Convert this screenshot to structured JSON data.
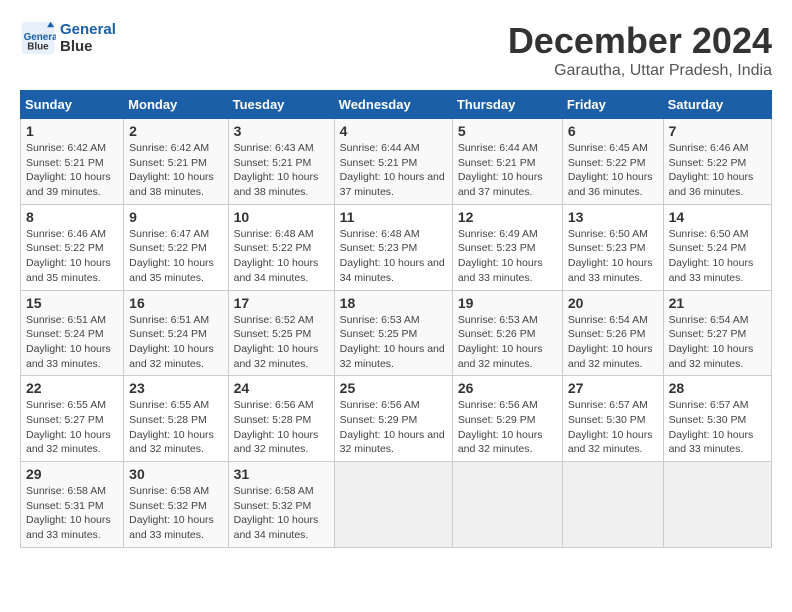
{
  "logo": {
    "line1": "General",
    "line2": "Blue"
  },
  "title": "December 2024",
  "subtitle": "Garautha, Uttar Pradesh, India",
  "weekdays": [
    "Sunday",
    "Monday",
    "Tuesday",
    "Wednesday",
    "Thursday",
    "Friday",
    "Saturday"
  ],
  "weeks": [
    [
      {
        "day": "1",
        "info": "Sunrise: 6:42 AM\nSunset: 5:21 PM\nDaylight: 10 hours and 39 minutes."
      },
      {
        "day": "2",
        "info": "Sunrise: 6:42 AM\nSunset: 5:21 PM\nDaylight: 10 hours and 38 minutes."
      },
      {
        "day": "3",
        "info": "Sunrise: 6:43 AM\nSunset: 5:21 PM\nDaylight: 10 hours and 38 minutes."
      },
      {
        "day": "4",
        "info": "Sunrise: 6:44 AM\nSunset: 5:21 PM\nDaylight: 10 hours and 37 minutes."
      },
      {
        "day": "5",
        "info": "Sunrise: 6:44 AM\nSunset: 5:21 PM\nDaylight: 10 hours and 37 minutes."
      },
      {
        "day": "6",
        "info": "Sunrise: 6:45 AM\nSunset: 5:22 PM\nDaylight: 10 hours and 36 minutes."
      },
      {
        "day": "7",
        "info": "Sunrise: 6:46 AM\nSunset: 5:22 PM\nDaylight: 10 hours and 36 minutes."
      }
    ],
    [
      {
        "day": "8",
        "info": "Sunrise: 6:46 AM\nSunset: 5:22 PM\nDaylight: 10 hours and 35 minutes."
      },
      {
        "day": "9",
        "info": "Sunrise: 6:47 AM\nSunset: 5:22 PM\nDaylight: 10 hours and 35 minutes."
      },
      {
        "day": "10",
        "info": "Sunrise: 6:48 AM\nSunset: 5:22 PM\nDaylight: 10 hours and 34 minutes."
      },
      {
        "day": "11",
        "info": "Sunrise: 6:48 AM\nSunset: 5:23 PM\nDaylight: 10 hours and 34 minutes."
      },
      {
        "day": "12",
        "info": "Sunrise: 6:49 AM\nSunset: 5:23 PM\nDaylight: 10 hours and 33 minutes."
      },
      {
        "day": "13",
        "info": "Sunrise: 6:50 AM\nSunset: 5:23 PM\nDaylight: 10 hours and 33 minutes."
      },
      {
        "day": "14",
        "info": "Sunrise: 6:50 AM\nSunset: 5:24 PM\nDaylight: 10 hours and 33 minutes."
      }
    ],
    [
      {
        "day": "15",
        "info": "Sunrise: 6:51 AM\nSunset: 5:24 PM\nDaylight: 10 hours and 33 minutes."
      },
      {
        "day": "16",
        "info": "Sunrise: 6:51 AM\nSunset: 5:24 PM\nDaylight: 10 hours and 32 minutes."
      },
      {
        "day": "17",
        "info": "Sunrise: 6:52 AM\nSunset: 5:25 PM\nDaylight: 10 hours and 32 minutes."
      },
      {
        "day": "18",
        "info": "Sunrise: 6:53 AM\nSunset: 5:25 PM\nDaylight: 10 hours and 32 minutes."
      },
      {
        "day": "19",
        "info": "Sunrise: 6:53 AM\nSunset: 5:26 PM\nDaylight: 10 hours and 32 minutes."
      },
      {
        "day": "20",
        "info": "Sunrise: 6:54 AM\nSunset: 5:26 PM\nDaylight: 10 hours and 32 minutes."
      },
      {
        "day": "21",
        "info": "Sunrise: 6:54 AM\nSunset: 5:27 PM\nDaylight: 10 hours and 32 minutes."
      }
    ],
    [
      {
        "day": "22",
        "info": "Sunrise: 6:55 AM\nSunset: 5:27 PM\nDaylight: 10 hours and 32 minutes."
      },
      {
        "day": "23",
        "info": "Sunrise: 6:55 AM\nSunset: 5:28 PM\nDaylight: 10 hours and 32 minutes."
      },
      {
        "day": "24",
        "info": "Sunrise: 6:56 AM\nSunset: 5:28 PM\nDaylight: 10 hours and 32 minutes."
      },
      {
        "day": "25",
        "info": "Sunrise: 6:56 AM\nSunset: 5:29 PM\nDaylight: 10 hours and 32 minutes."
      },
      {
        "day": "26",
        "info": "Sunrise: 6:56 AM\nSunset: 5:29 PM\nDaylight: 10 hours and 32 minutes."
      },
      {
        "day": "27",
        "info": "Sunrise: 6:57 AM\nSunset: 5:30 PM\nDaylight: 10 hours and 32 minutes."
      },
      {
        "day": "28",
        "info": "Sunrise: 6:57 AM\nSunset: 5:30 PM\nDaylight: 10 hours and 33 minutes."
      }
    ],
    [
      {
        "day": "29",
        "info": "Sunrise: 6:58 AM\nSunset: 5:31 PM\nDaylight: 10 hours and 33 minutes."
      },
      {
        "day": "30",
        "info": "Sunrise: 6:58 AM\nSunset: 5:32 PM\nDaylight: 10 hours and 33 minutes."
      },
      {
        "day": "31",
        "info": "Sunrise: 6:58 AM\nSunset: 5:32 PM\nDaylight: 10 hours and 34 minutes."
      },
      null,
      null,
      null,
      null
    ]
  ]
}
